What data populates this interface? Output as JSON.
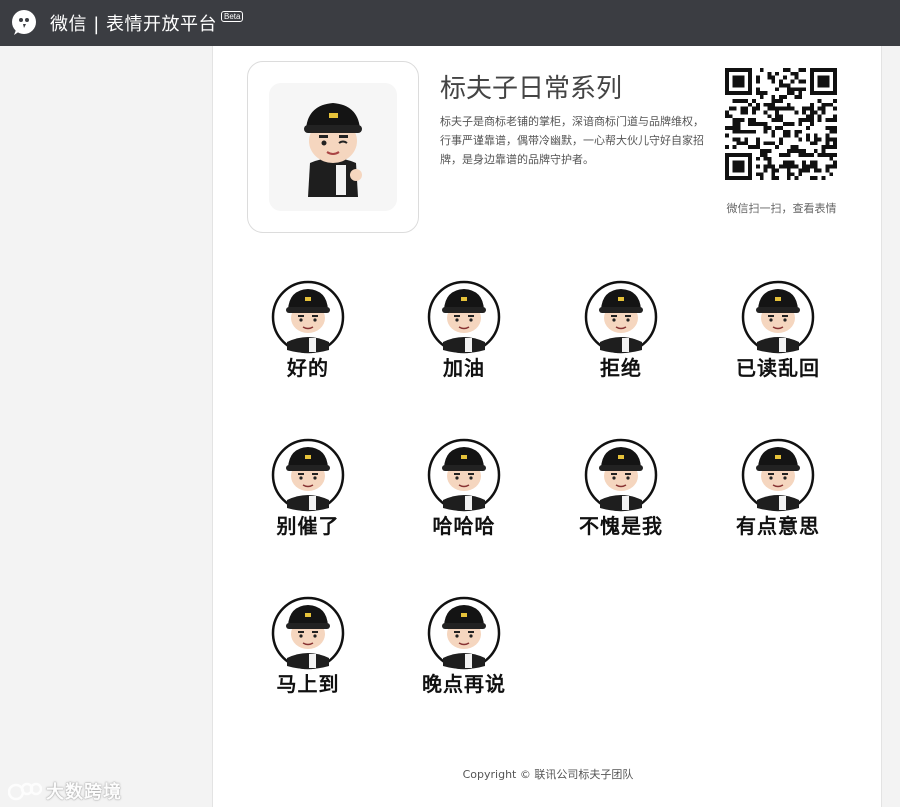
{
  "header": {
    "title": "微信 | 表情开放平台",
    "beta_badge": "Beta",
    "logo_icon": "wechat-logo-icon"
  },
  "pack": {
    "title": "标夫子日常系列",
    "description": "标夫子是商标老铺的掌柜，深谙商标门道与品牌维权，行事严谨靠谱，偶带冷幽默，一心帮大伙儿守好自家招牌，是身边靠谱的品牌守护者。",
    "qr_caption": "微信扫一扫，查看表情"
  },
  "stickers": [
    {
      "label": "好的"
    },
    {
      "label": "加油"
    },
    {
      "label": "拒绝"
    },
    {
      "label": "已读乱回"
    },
    {
      "label": "别催了"
    },
    {
      "label": "哈哈哈"
    },
    {
      "label": "不愧是我"
    },
    {
      "label": "有点意思"
    },
    {
      "label": "马上到"
    },
    {
      "label": "晚点再说"
    }
  ],
  "footer": {
    "copyright": "Copyright © 联讯公司标夫子团队"
  },
  "watermark": {
    "text": "大数跨境"
  },
  "colors": {
    "topbar": "#3b3d42",
    "content_bg": "#ffffff",
    "page_bg": "#f3f3f3"
  }
}
